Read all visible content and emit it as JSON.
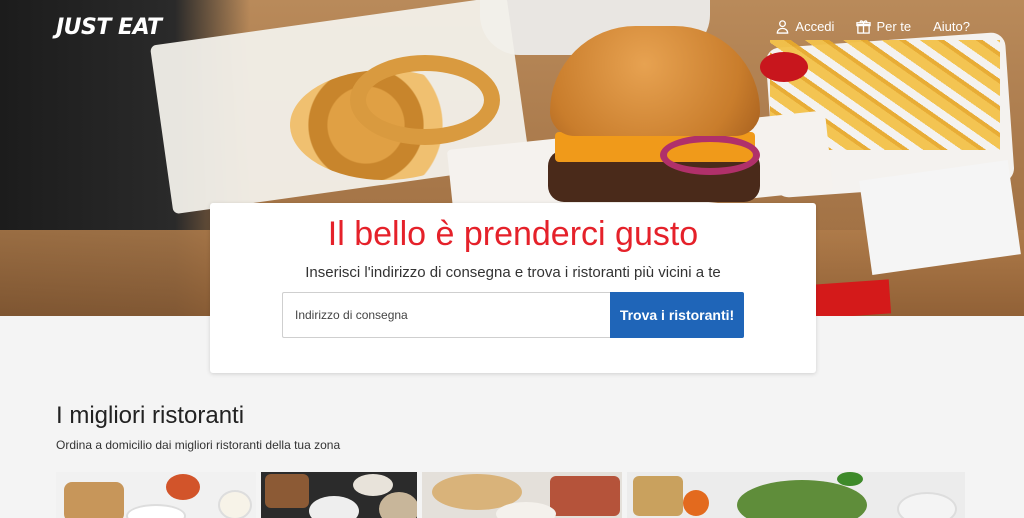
{
  "brand": {
    "logo_text": "JUST EAT"
  },
  "nav": {
    "login_label": "Accedi",
    "for_you_label": "Per te",
    "help_label": "Aiuto?"
  },
  "hero": {
    "title": "Il bello è prenderci gusto",
    "subtitle": "Inserisci l'indirizzo di consegna e trova i ristoranti più vicini a te",
    "search_placeholder": "Indirizzo di consegna",
    "search_button_label": "Trova i ristoranti!"
  },
  "best_restaurants": {
    "title": "I migliori ristoranti",
    "subtitle": "Ordina a domicilio dai migliori ristoranti della tua zona"
  },
  "colors": {
    "brand_red": "#e5212a",
    "button_blue": "#1f65b8",
    "page_background": "#f4f4f4"
  },
  "icons": {
    "login": "user-icon",
    "for_you": "gift-icon"
  }
}
